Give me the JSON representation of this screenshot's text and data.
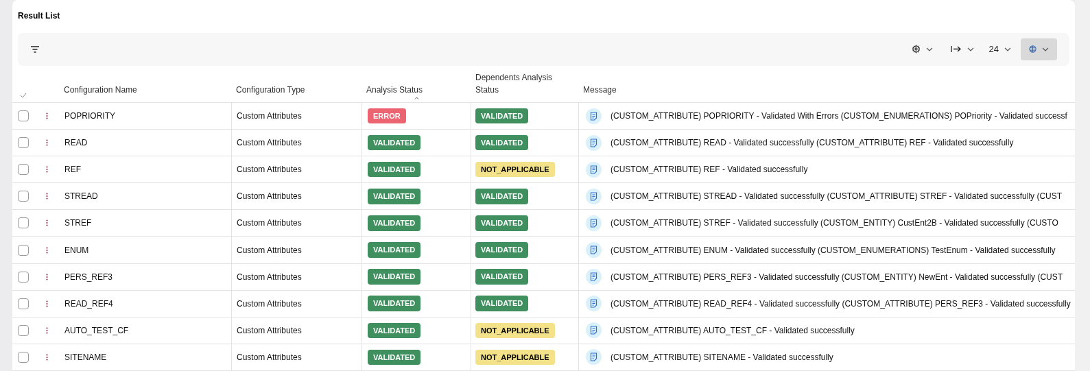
{
  "panel": {
    "title": "Result List"
  },
  "toolbar": {
    "page_size": "24"
  },
  "table": {
    "columns": [
      {
        "label": "Configuration Name"
      },
      {
        "label": "Configuration Type"
      },
      {
        "label": "Analysis Status",
        "sorted": true
      },
      {
        "label": "Dependents Analysis Status"
      },
      {
        "label": "Message"
      }
    ],
    "rows": [
      {
        "checked": false,
        "name": "POPRIORITY",
        "type": "Custom Attributes",
        "analysis": {
          "label": "ERROR",
          "kind": "error"
        },
        "dependents": {
          "label": "VALIDATED",
          "kind": "validated"
        },
        "message": "(CUSTOM_ATTRIBUTE) POPRIORITY - Validated With Errors (CUSTOM_ENUMERATIONS) POPriority - Validated successf"
      },
      {
        "checked": false,
        "name": "READ",
        "type": "Custom Attributes",
        "analysis": {
          "label": "VALIDATED",
          "kind": "validated"
        },
        "dependents": {
          "label": "VALIDATED",
          "kind": "validated"
        },
        "message": "(CUSTOM_ATTRIBUTE) READ - Validated successfully (CUSTOM_ATTRIBUTE) REF - Validated successfully"
      },
      {
        "checked": false,
        "name": "REF",
        "type": "Custom Attributes",
        "analysis": {
          "label": "VALIDATED",
          "kind": "validated"
        },
        "dependents": {
          "label": "NOT_APPLICABLE",
          "kind": "not_applicable"
        },
        "message": "(CUSTOM_ATTRIBUTE) REF - Validated successfully"
      },
      {
        "checked": false,
        "name": "STREAD",
        "type": "Custom Attributes",
        "analysis": {
          "label": "VALIDATED",
          "kind": "validated"
        },
        "dependents": {
          "label": "VALIDATED",
          "kind": "validated"
        },
        "message": "(CUSTOM_ATTRIBUTE) STREAD - Validated successfully (CUSTOM_ATTRIBUTE) STREF - Validated successfully (CUST"
      },
      {
        "checked": false,
        "name": "STREF",
        "type": "Custom Attributes",
        "analysis": {
          "label": "VALIDATED",
          "kind": "validated"
        },
        "dependents": {
          "label": "VALIDATED",
          "kind": "validated"
        },
        "message": "(CUSTOM_ATTRIBUTE) STREF - Validated successfully (CUSTOM_ENTITY) CustEnt2B - Validated successfully (CUSTO"
      },
      {
        "checked": false,
        "name": "ENUM",
        "type": "Custom Attributes",
        "analysis": {
          "label": "VALIDATED",
          "kind": "validated"
        },
        "dependents": {
          "label": "VALIDATED",
          "kind": "validated"
        },
        "message": "(CUSTOM_ATTRIBUTE) ENUM - Validated successfully (CUSTOM_ENUMERATIONS) TestEnum - Validated successfully"
      },
      {
        "checked": false,
        "name": "PERS_REF3",
        "type": "Custom Attributes",
        "analysis": {
          "label": "VALIDATED",
          "kind": "validated"
        },
        "dependents": {
          "label": "VALIDATED",
          "kind": "validated"
        },
        "message": "(CUSTOM_ATTRIBUTE) PERS_REF3 - Validated successfully (CUSTOM_ENTITY) NewEnt - Validated successfully (CUST"
      },
      {
        "checked": false,
        "name": "READ_REF4",
        "type": "Custom Attributes",
        "analysis": {
          "label": "VALIDATED",
          "kind": "validated"
        },
        "dependents": {
          "label": "VALIDATED",
          "kind": "validated"
        },
        "message": "(CUSTOM_ATTRIBUTE) READ_REF4 - Validated successfully (CUSTOM_ATTRIBUTE) PERS_REF3 - Validated successfully"
      },
      {
        "checked": false,
        "name": "AUTO_TEST_CF",
        "type": "Custom Attributes",
        "analysis": {
          "label": "VALIDATED",
          "kind": "validated"
        },
        "dependents": {
          "label": "NOT_APPLICABLE",
          "kind": "not_applicable"
        },
        "message": "(CUSTOM_ATTRIBUTE) AUTO_TEST_CF - Validated successfully"
      },
      {
        "checked": false,
        "name": "SITENAME",
        "type": "Custom Attributes",
        "analysis": {
          "label": "VALIDATED",
          "kind": "validated"
        },
        "dependents": {
          "label": "NOT_APPLICABLE",
          "kind": "not_applicable"
        },
        "message": "(CUSTOM_ATTRIBUTE) SITENAME - Validated successfully"
      }
    ]
  }
}
